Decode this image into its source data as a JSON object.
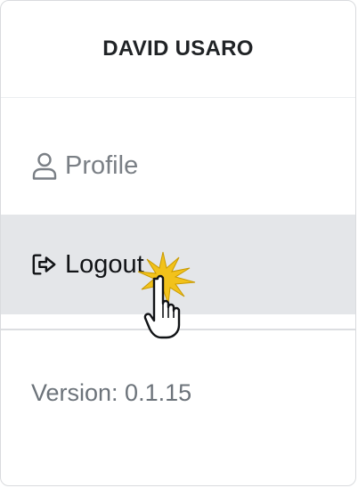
{
  "user": {
    "name": "DAVID USARO"
  },
  "menu": {
    "items": [
      {
        "label": "Profile",
        "icon": "person-icon"
      },
      {
        "label": "Logout",
        "icon": "logout-icon"
      }
    ]
  },
  "footer": {
    "version_text": "Version: 0.1.15"
  },
  "colors": {
    "highlight_bg": "#e4e6e9",
    "muted_text": "#7a7f85",
    "primary_text": "#111316",
    "click_burst": "#f2c21b"
  }
}
